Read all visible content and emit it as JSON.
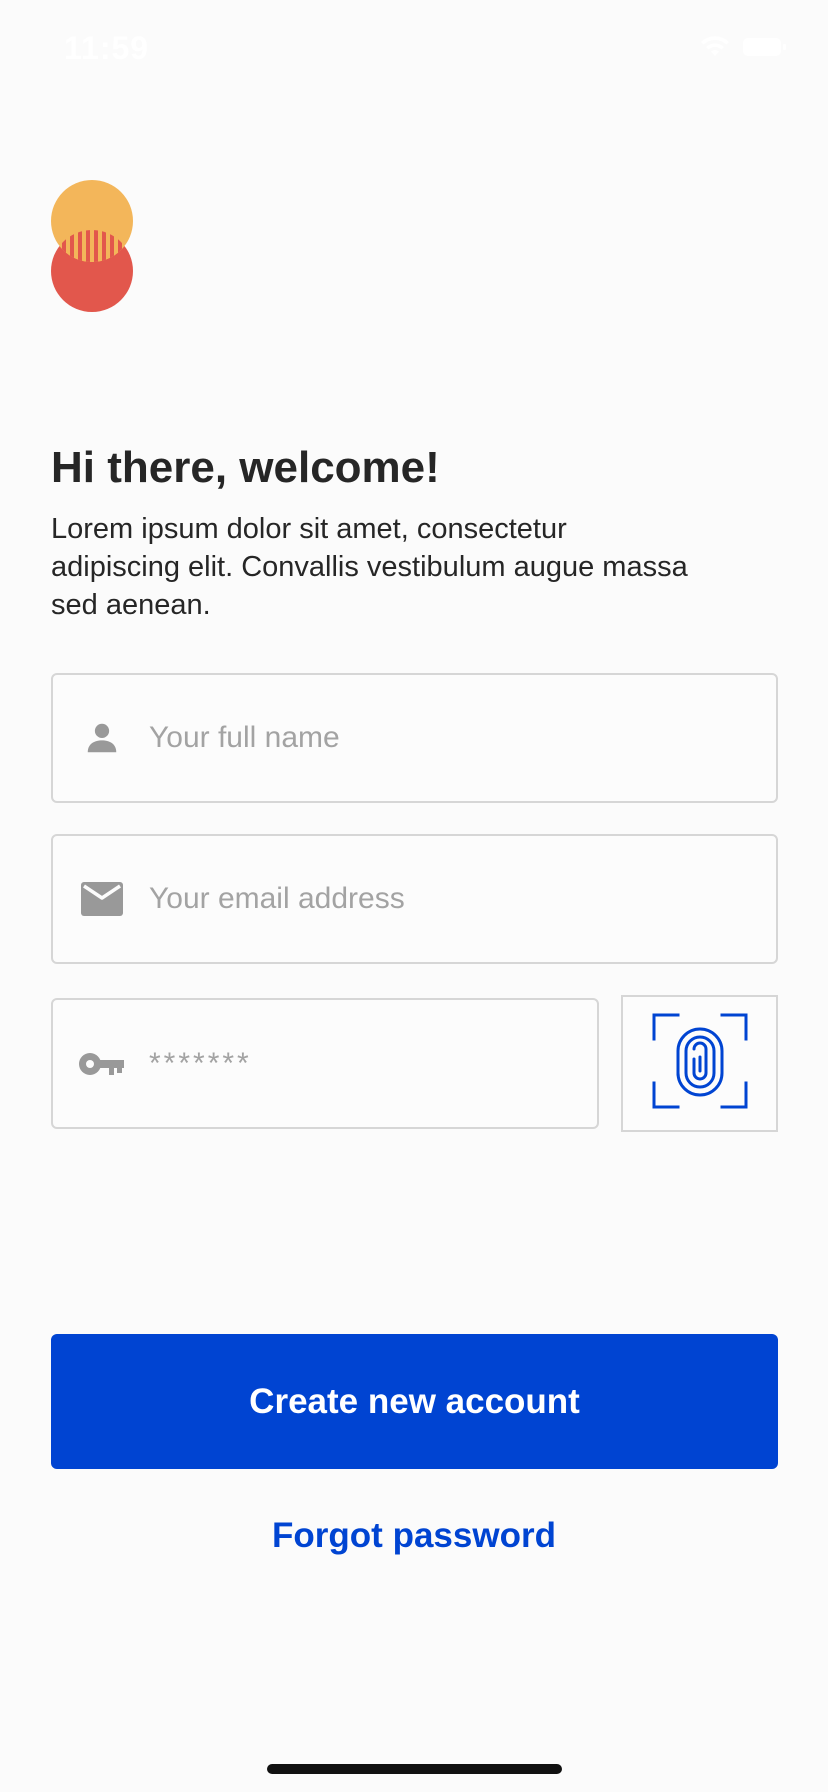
{
  "status_bar": {
    "time": "11:59",
    "wifi_icon": "wifi-icon",
    "battery_icon": "battery-icon"
  },
  "logo": {
    "colors": [
      "#f3b65a",
      "#e2574c"
    ]
  },
  "welcome": {
    "title": "Hi there, welcome!",
    "description": "Lorem ipsum dolor sit amet, consectetur adipiscing elit. Convallis vestibulum augue massa sed aenean."
  },
  "form": {
    "name": {
      "icon": "person-icon",
      "placeholder": "Your full name",
      "value": ""
    },
    "email": {
      "icon": "mail-icon",
      "placeholder": "Your email address",
      "value": ""
    },
    "password": {
      "icon": "key-icon",
      "placeholder": "*******",
      "value": ""
    },
    "biometric": {
      "icon": "fingerprint-icon"
    }
  },
  "actions": {
    "create_account_label": "Create new account",
    "forgot_password_label": "Forgot password"
  },
  "theme": {
    "accent": "#0044d2",
    "field_border": "#d6d6d6",
    "icon_gray": "#999999"
  }
}
